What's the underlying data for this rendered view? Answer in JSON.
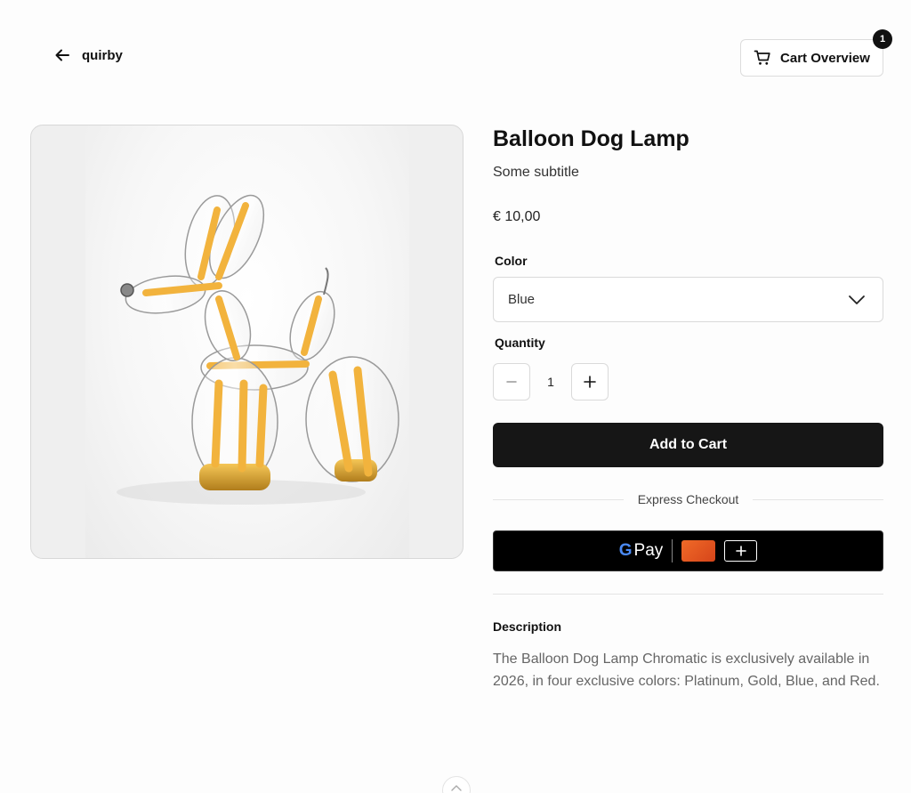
{
  "header": {
    "back_label": "quirby",
    "cart_label": "Cart Overview",
    "cart_count": "1"
  },
  "product": {
    "title": "Balloon Dog Lamp",
    "subtitle": "Some subtitle",
    "price": "€ 10,00",
    "color_label": "Color",
    "color_value": "Blue",
    "quantity_label": "Quantity",
    "quantity_value": "1",
    "add_to_cart_label": "Add to Cart",
    "express_checkout_label": "Express Checkout",
    "gpay_label": "Pay",
    "gpay_g": "G",
    "description_heading": "Description",
    "description_text": "The Balloon Dog Lamp Chromatic is exclusively available in 2026, in four exclusive colors: Platinum, Gold, Blue, and Red."
  },
  "colors": {
    "primary_button": "#161616",
    "gpay_button": "#000000",
    "lamp_gold": "#f2b33d",
    "card_orange": "#e8572a"
  },
  "icons": {
    "back": "arrow-left-icon",
    "cart": "shopping-cart-icon",
    "select": "chevron-down-icon",
    "minus": "minus-icon",
    "plus": "plus-icon",
    "scroll": "chevron-up-icon"
  }
}
